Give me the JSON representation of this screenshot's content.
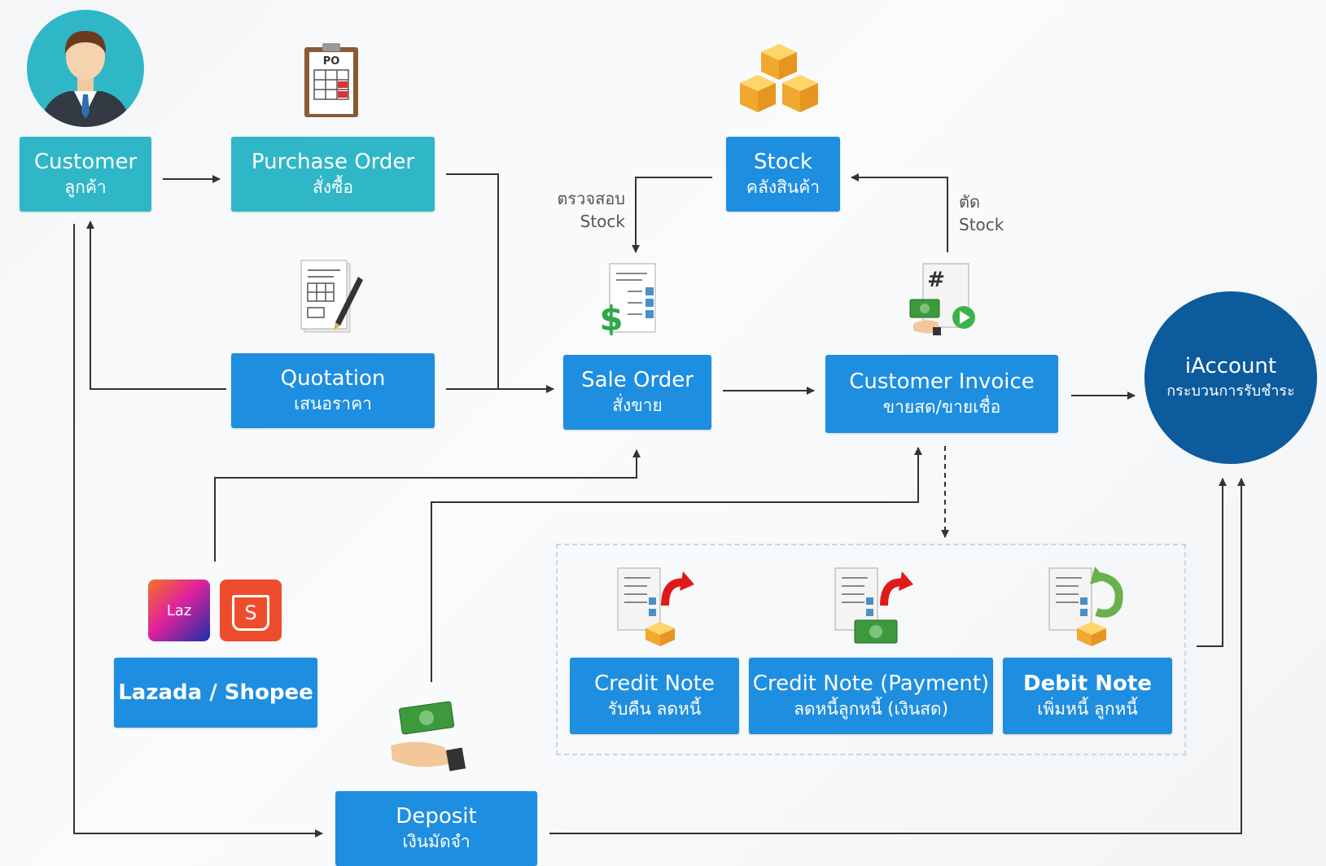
{
  "nodes": {
    "customer": {
      "title": "Customer",
      "sub": "ลูกค้า"
    },
    "purchase_order": {
      "title": "Purchase Order",
      "sub": "สั่งซื้อ"
    },
    "stock": {
      "title": "Stock",
      "sub": "คลังสินค้า"
    },
    "quotation": {
      "title": "Quotation",
      "sub": "เสนอราคา"
    },
    "sale_order": {
      "title": "Sale Order",
      "sub": "สั่งขาย"
    },
    "customer_invoice": {
      "title": "Customer Invoice",
      "sub": "ขายสด/ขายเชื่อ"
    },
    "iaccount": {
      "title": "iAccount",
      "sub": "กระบวนการรับชำระ"
    },
    "lazada_shopee": {
      "title": "Lazada / Shopee"
    },
    "credit_note": {
      "title": "Credit Note",
      "sub": "รับคืน ลดหนี้"
    },
    "credit_note_payment": {
      "title": "Credit Note (Payment)",
      "sub": "ลดหนี้ลูกหนี้ (เงินสด)"
    },
    "debit_note": {
      "title": "Debit Note",
      "sub": "เพิ่มหนี้ ลูกหนี้"
    },
    "deposit": {
      "title": "Deposit",
      "sub": "เงินมัดจำ"
    }
  },
  "notes": {
    "check_stock_1": "ตรวจสอบ",
    "check_stock_2": "Stock",
    "cut_stock_1": "ตัด",
    "cut_stock_2": "Stock"
  },
  "icons": {
    "po_text": "PO",
    "hash": "#",
    "laz": "Laz",
    "shopee": "S"
  },
  "colors": {
    "teal": "#2fb7c7",
    "blue": "#1e8ee0",
    "navy": "#0c5b9d",
    "line": "#333333"
  }
}
